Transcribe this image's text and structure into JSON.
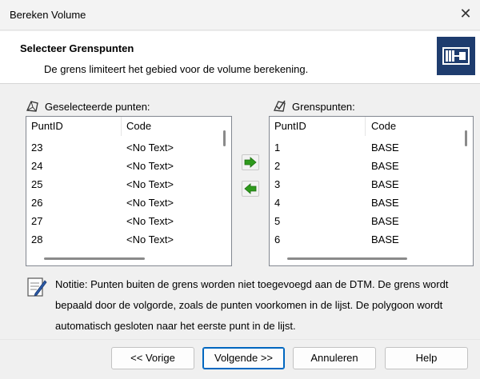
{
  "window": {
    "title": "Bereken Volume",
    "close_glyph": "✕"
  },
  "header": {
    "title": "Selecteer Grenspunten",
    "subtitle": "De grens limiteert het gebied voor de volume berekening.",
    "icon": "boundary-dialog-icon"
  },
  "left_list": {
    "label": "Geselecteerde punten:",
    "icon": "selected-points-icon",
    "columns": [
      "PuntID",
      "Code"
    ],
    "rows": [
      [
        "23",
        "<No Text>"
      ],
      [
        "24",
        "<No Text>"
      ],
      [
        "25",
        "<No Text>"
      ],
      [
        "26",
        "<No Text>"
      ],
      [
        "27",
        "<No Text>"
      ],
      [
        "28",
        "<No Text>"
      ]
    ]
  },
  "right_list": {
    "label": "Grenspunten:",
    "icon": "boundary-points-icon",
    "columns": [
      "PuntID",
      "Code"
    ],
    "rows": [
      [
        "1",
        "BASE"
      ],
      [
        "2",
        "BASE"
      ],
      [
        "3",
        "BASE"
      ],
      [
        "4",
        "BASE"
      ],
      [
        "5",
        "BASE"
      ],
      [
        "6",
        "BASE"
      ]
    ]
  },
  "transfer": {
    "add_icon": "arrow-right-icon",
    "remove_icon": "arrow-left-icon",
    "arrow_color": "#2e9a1c"
  },
  "notice": {
    "icon": "note-icon",
    "text": "Notitie: Punten buiten de grens worden niet toegevoegd aan de DTM. De grens wordt bepaald door de volgorde, zoals de punten voorkomen in de lijst. De polygoon wordt automatisch gesloten naar het eerste punt in de lijst."
  },
  "buttons": {
    "prev": "<< Vorige",
    "next": "Volgende >>",
    "cancel": "Annuleren",
    "help": "Help"
  },
  "colors": {
    "accent": "#0067c0",
    "header_icon_bg": "#1e3c6e"
  }
}
